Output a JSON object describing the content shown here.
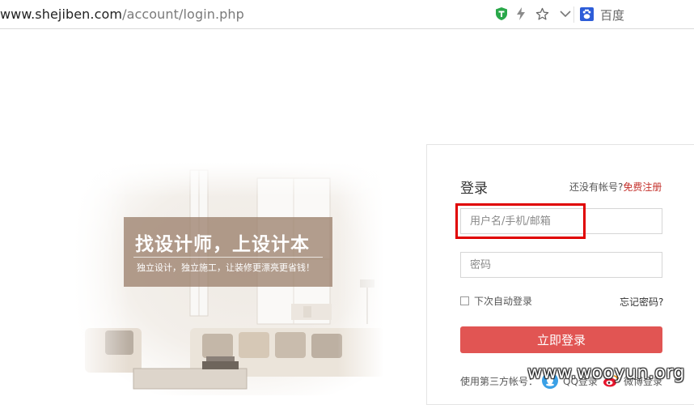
{
  "browser": {
    "url_host": "www.shejiben.com",
    "url_path": "/account/login.php",
    "search_engine_label": "百度",
    "icons": [
      "shield-t-icon",
      "lightning-icon",
      "star-icon",
      "chevron-down-icon",
      "baidu-paw-icon"
    ]
  },
  "hero": {
    "title": "找设计师，上设计本",
    "subtitle": "独立设计，独立施工，让装修更漂亮更省钱！"
  },
  "login": {
    "title": "登录",
    "no_account_text": "还没有帐号?",
    "register_link": "免费注册",
    "username_placeholder": "用户名/手机/邮箱",
    "password_placeholder": "密码",
    "remember_label": "下次自动登录",
    "forgot_link": "忘记密码?",
    "submit_label": "立即登录",
    "third_party_label": "使用第三方帐号：",
    "qq_label": "QQ登录",
    "weibo_label": "微博登录"
  },
  "colors": {
    "accent_red": "#e15553",
    "register_red": "#c4302b",
    "highlight_box": "#e00000"
  },
  "watermark": "www.wooyun.org"
}
